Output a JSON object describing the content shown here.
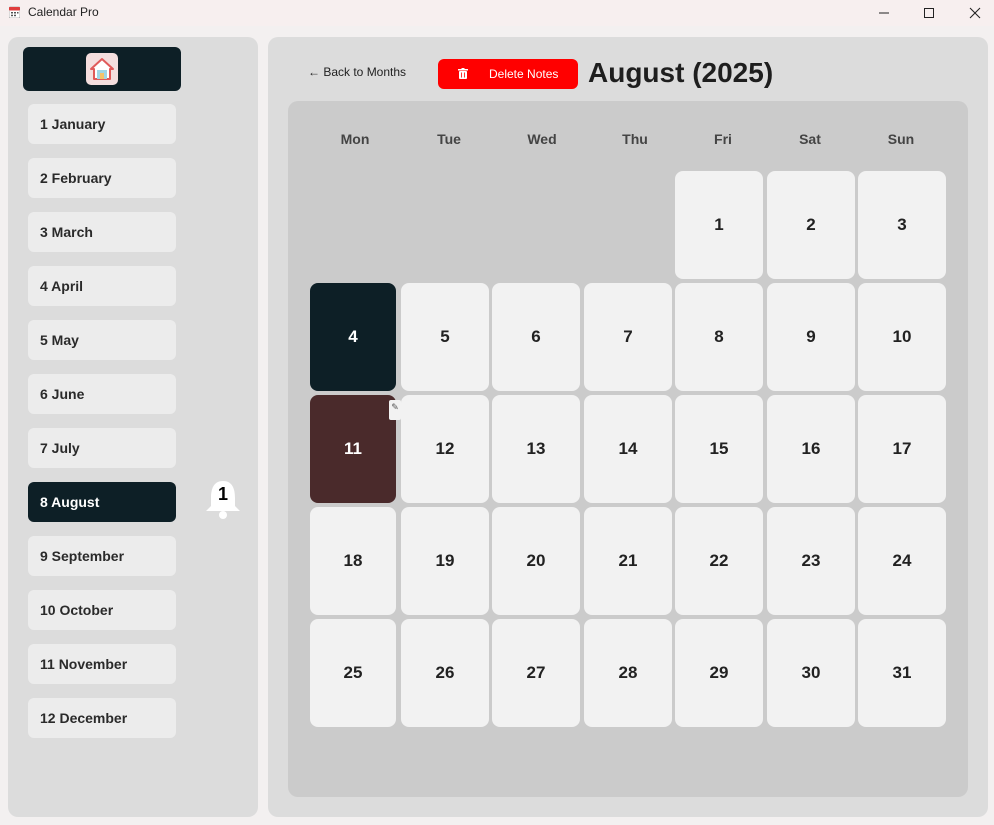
{
  "window": {
    "title": "Calendar Pro",
    "controls": [
      "minimize",
      "maximize",
      "close"
    ]
  },
  "sidebar": {
    "home_icon": "house-icon",
    "months": [
      {
        "label": "1 January",
        "active": false
      },
      {
        "label": "2 February",
        "active": false
      },
      {
        "label": "3 March",
        "active": false
      },
      {
        "label": "4 April",
        "active": false
      },
      {
        "label": "5 May",
        "active": false
      },
      {
        "label": "6 June",
        "active": false
      },
      {
        "label": "7 July",
        "active": false
      },
      {
        "label": "8 August",
        "active": true
      },
      {
        "label": "9 September",
        "active": false
      },
      {
        "label": "10 October",
        "active": false
      },
      {
        "label": "11 November",
        "active": false
      },
      {
        "label": "12 December",
        "active": false
      }
    ],
    "notification_count": "1"
  },
  "header": {
    "back_label": "← Back to Months",
    "delete_label": "Delete Notes",
    "month_title": "August (2025)"
  },
  "calendar": {
    "weekdays": [
      "Mon",
      "Tue",
      "Wed",
      "Thu",
      "Fri",
      "Sat",
      "Sun"
    ],
    "first_weekday_index": 4,
    "days_in_month": 31,
    "today": 4,
    "noted_days": [
      11
    ]
  },
  "colors": {
    "accent_dark": "#0d1f26",
    "delete_red": "#ff0000",
    "noted_day": "#4a2a2b",
    "cell_bg": "#f2f2f2"
  }
}
